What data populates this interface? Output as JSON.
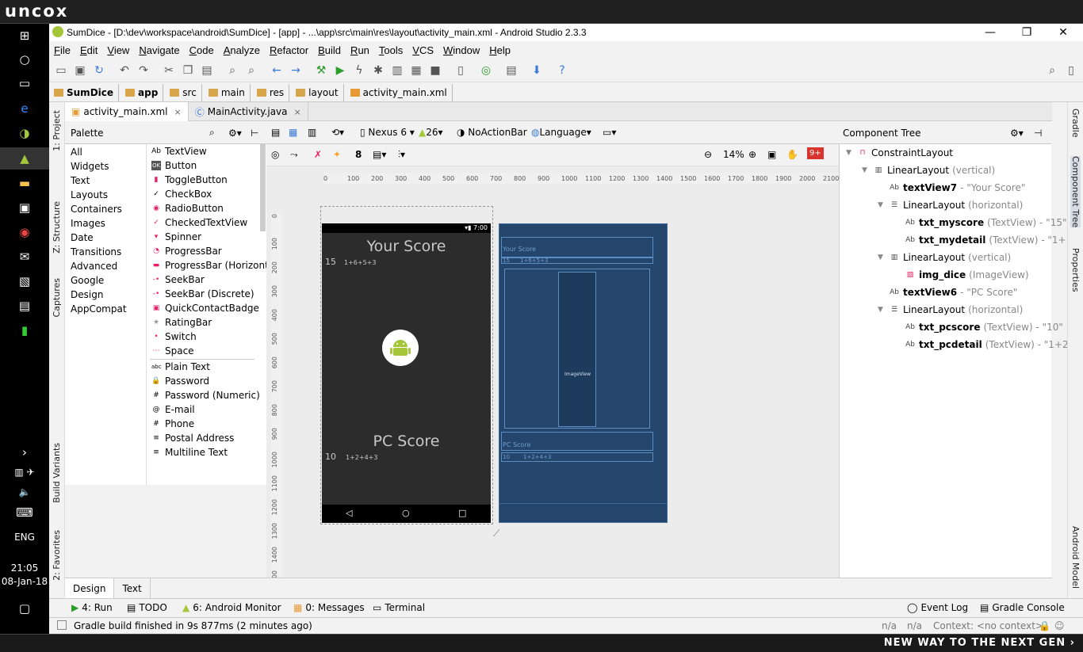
{
  "banner": {
    "logo": "uncox",
    "slogan": "NEW WAY TO THE NEXT GEN ›"
  },
  "taskbar": {
    "time": "21:05",
    "date": "08-Jan-18",
    "lang": "ENG"
  },
  "window": {
    "title": "SumDice - [D:\\dev\\workspace\\android\\SumDice] - [app] - ...\\app\\src\\main\\res\\layout\\activity_main.xml - Android Studio 2.3.3",
    "min": "—",
    "max": "❐",
    "close": "✕"
  },
  "menu": [
    "File",
    "Edit",
    "View",
    "Navigate",
    "Code",
    "Analyze",
    "Refactor",
    "Build",
    "Run",
    "Tools",
    "VCS",
    "Window",
    "Help"
  ],
  "breadcrumb": [
    "SumDice",
    "app",
    "src",
    "main",
    "res",
    "layout",
    "activity_main.xml"
  ],
  "tabs": [
    {
      "label": "activity_main.xml",
      "close": "×"
    },
    {
      "label": "MainActivity.java",
      "close": "×"
    }
  ],
  "left_strip": {
    "project": "1: Project",
    "structure": "Z: Structure",
    "captures": "Captures",
    "build_variants": "Build Variants",
    "favorites": "2: Favorites"
  },
  "right_strip": {
    "gradle": "Gradle",
    "component_tree": "Component Tree",
    "properties": "Properties",
    "android_model": "Android Model"
  },
  "palette": {
    "title": "Palette",
    "categories": [
      "All",
      "Widgets",
      "Text",
      "Layouts",
      "Containers",
      "Images",
      "Date",
      "Transitions",
      "Advanced",
      "Google",
      "Design",
      "AppCompat"
    ],
    "widgets": [
      {
        "icon": "Ab",
        "label": "TextView"
      },
      {
        "icon": "OK",
        "label": "Button"
      },
      {
        "icon": "▮",
        "label": "ToggleButton"
      },
      {
        "icon": "✓",
        "label": "CheckBox"
      },
      {
        "icon": "◉",
        "label": "RadioButton"
      },
      {
        "icon": "✓",
        "label": "CheckedTextView"
      },
      {
        "icon": "▾",
        "label": "Spinner"
      },
      {
        "icon": "◔",
        "label": "ProgressBar"
      },
      {
        "icon": "▬",
        "label": "ProgressBar (Horizont"
      },
      {
        "icon": "-•",
        "label": "SeekBar"
      },
      {
        "icon": "-•",
        "label": "SeekBar (Discrete)"
      },
      {
        "icon": "▣",
        "label": "QuickContactBadge"
      },
      {
        "icon": "★",
        "label": "RatingBar"
      },
      {
        "icon": "•",
        "label": "Switch"
      },
      {
        "icon": "⋯",
        "label": "Space"
      },
      {
        "icon": "abc",
        "label": "Plain Text"
      },
      {
        "icon": "🔒",
        "label": "Password"
      },
      {
        "icon": "#",
        "label": "Password (Numeric)"
      },
      {
        "icon": "@",
        "label": "E-mail"
      },
      {
        "icon": "#",
        "label": "Phone"
      },
      {
        "icon": "≡",
        "label": "Postal Address"
      },
      {
        "icon": "≡",
        "label": "Multiline Text"
      }
    ]
  },
  "design_toolbar": {
    "device": "Nexus 6",
    "api": "26",
    "theme": "NoActionBar",
    "language": "Language",
    "zoom": "14%",
    "snap": "8",
    "warnings": "9+"
  },
  "hruler_ticks": [
    "0",
    "100",
    "200",
    "300",
    "400",
    "500",
    "600",
    "700",
    "800",
    "900",
    "1000",
    "1100",
    "1200",
    "1300",
    "1400",
    "1500",
    "1600",
    "1700",
    "1800",
    "1900",
    "2000",
    "2100"
  ],
  "vruler_ticks": [
    "0",
    "100",
    "200",
    "300",
    "400",
    "500",
    "600",
    "700",
    "800",
    "900",
    "1000",
    "1100",
    "1200",
    "1300",
    "1400",
    "1500"
  ],
  "device": {
    "status_time": "7:00",
    "your_score": "Your Score",
    "my_score": "15",
    "my_detail": "1+6+5+3",
    "pc_score_title": "PC Score",
    "pc_score": "10",
    "pc_detail": "1+2+4+3"
  },
  "blueprint": {
    "your_score": "Your Score",
    "my_score": "15",
    "my_detail": "1+6+5+3",
    "image_label": "ImageView",
    "pc_score_title": "PC Score",
    "pc_score": "10",
    "pc_detail": "1+2+4+3"
  },
  "component_tree": {
    "title": "Component Tree",
    "nodes": [
      {
        "name": "ConstraintLayout",
        "hint": ""
      },
      {
        "name": "LinearLayout",
        "hint": "(vertical)"
      },
      {
        "name": "textView7",
        "hint": "- \"Your Score\""
      },
      {
        "name": "LinearLayout",
        "hint": "(horizontal)"
      },
      {
        "name": "txt_myscore",
        "hint": "(TextView) - \"15\""
      },
      {
        "name": "txt_mydetail",
        "hint": "(TextView) - \"1+"
      },
      {
        "name": "LinearLayout",
        "hint": "(vertical)"
      },
      {
        "name": "img_dice",
        "hint": "(ImageView)"
      },
      {
        "name": "textView6",
        "hint": "- \"PC Score\""
      },
      {
        "name": "LinearLayout",
        "hint": "(horizontal)"
      },
      {
        "name": "txt_pcscore",
        "hint": "(TextView) - \"10\""
      },
      {
        "name": "txt_pcdetail",
        "hint": "(TextView) - \"1+2"
      }
    ]
  },
  "editor_tabs": [
    "Design",
    "Text"
  ],
  "tool_windows": {
    "run": "4: Run",
    "todo": "TODO",
    "monitor": "6: Android Monitor",
    "messages": "0: Messages",
    "terminal": "Terminal",
    "event_log": "Event Log",
    "gradle_console": "Gradle Console"
  },
  "status": {
    "message": "Gradle build finished in 9s 877ms (2 minutes ago)",
    "na1": "n/a",
    "na2": "n/a",
    "context": "Context: <no context>"
  },
  "colors": {
    "accent": "#3d7bd6",
    "blueprint": "#24466c",
    "android_green": "#a4c639",
    "pink": "#e91e63"
  }
}
